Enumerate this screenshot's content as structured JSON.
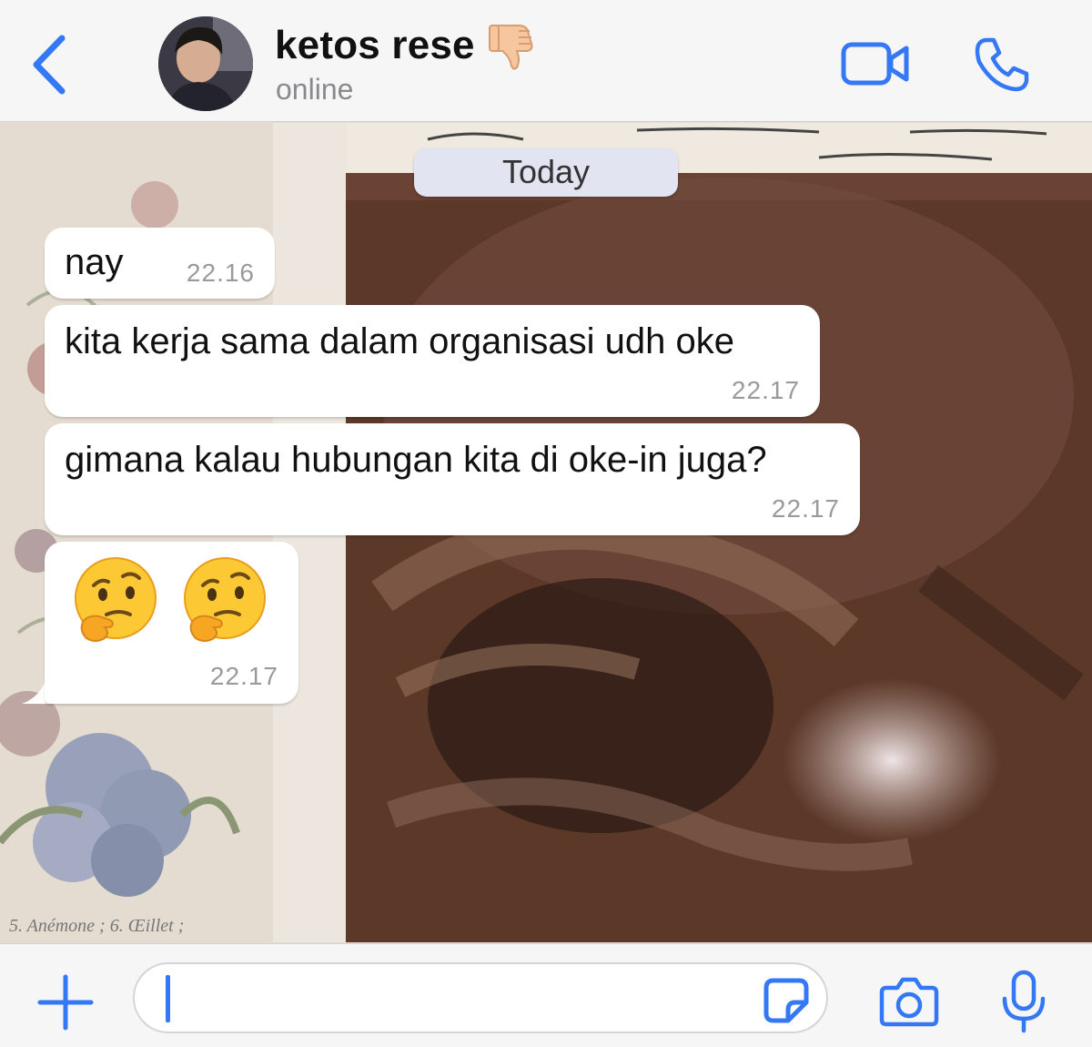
{
  "header": {
    "contact_name": "ketos rese",
    "contact_status": "online",
    "name_emoji": "thumbs-down-emoji",
    "icons": {
      "back": "chevron-left-icon",
      "video": "video-camera-icon",
      "call": "phone-icon"
    }
  },
  "chat": {
    "date_divider": "Today",
    "messages": [
      {
        "text": "nay",
        "time": "22.16"
      },
      {
        "text": "kita kerja sama dalam organisasi udh oke",
        "time": "22.17"
      },
      {
        "text": "gimana kalau hubungan kita di oke-in juga?",
        "time": "22.17"
      },
      {
        "emoji": [
          "thinking-face-emoji",
          "thinking-face-emoji"
        ],
        "time": "22.17"
      }
    ]
  },
  "input_bar": {
    "message_value": "",
    "icons": {
      "add": "plus-icon",
      "sticker": "sticker-icon",
      "camera": "camera-icon",
      "mic": "microphone-icon"
    }
  },
  "colors": {
    "accent": "#3478f6",
    "bubble": "#ffffff",
    "bar": "#f6f6f6",
    "date_pill": "#e2e4f1"
  }
}
